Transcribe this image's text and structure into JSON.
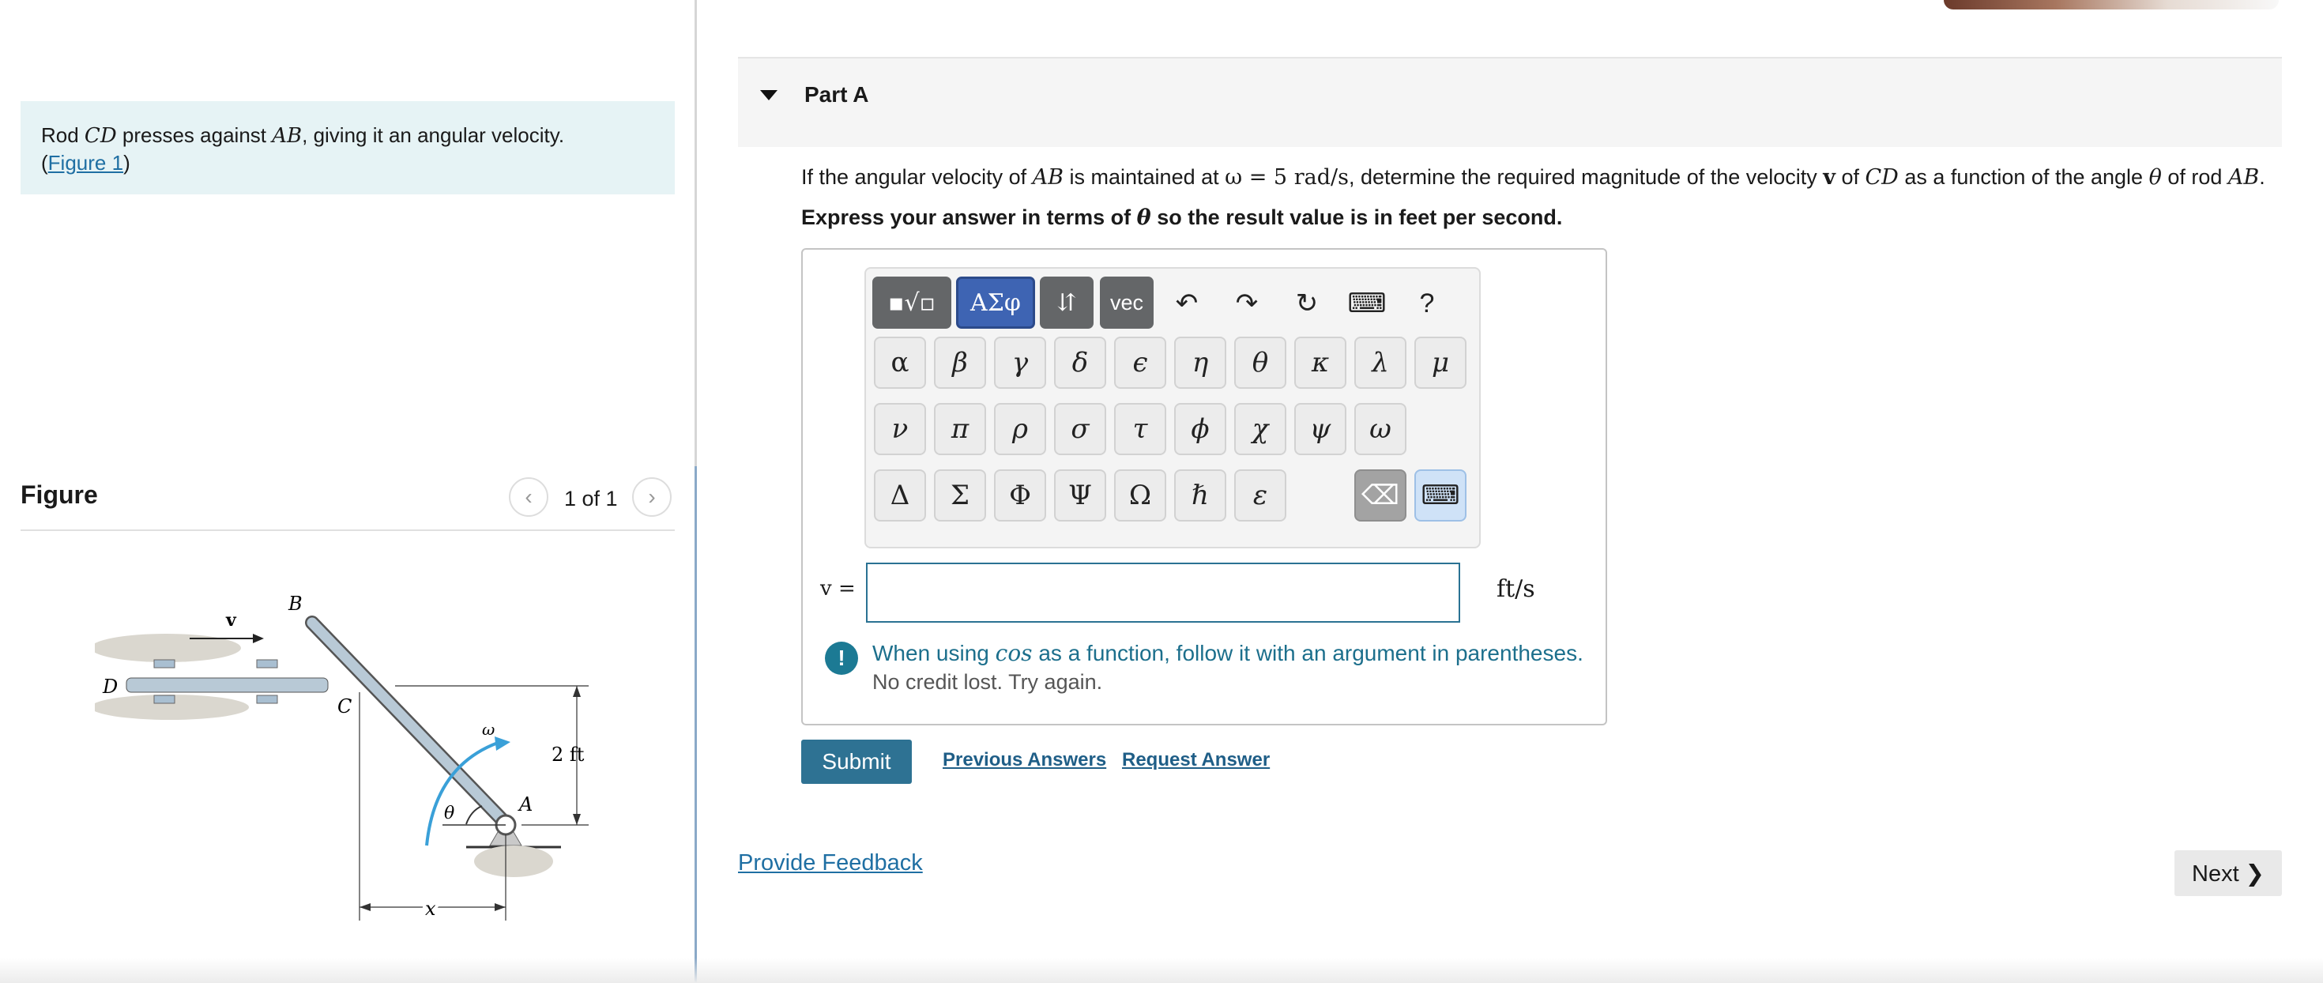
{
  "left": {
    "prompt_text_a": "Rod ",
    "prompt_math_a": "CD",
    "prompt_text_b": " presses against ",
    "prompt_math_b": "AB",
    "prompt_text_c": ", giving it an angular velocity.",
    "prompt_paren_open": "(",
    "figure_link": "Figure 1",
    "prompt_paren_close": ")",
    "figure_title": "Figure",
    "figure_count": "1 of 1",
    "prev_icon": "chevron-left-icon",
    "next_icon": "chevron-right-icon",
    "figure_labels": {
      "B": "B",
      "D": "D",
      "C": "C",
      "A": "A",
      "v": "v",
      "omega": "ω",
      "theta": "θ",
      "dim": "2 ft",
      "x": "x"
    },
    "figure_colors": {
      "ground": "#d9d6cf",
      "rod": "#b8c9d6",
      "arrow": "#3aa0d8",
      "stone": "#9c9790"
    }
  },
  "part": {
    "title": "Part A",
    "q_1": "If the angular velocity of ",
    "q_ab": "AB",
    "q_2": " is maintained at ",
    "q_omega": "ω = 5 rad/s",
    "q_3": ", determine the required magnitude of the velocity ",
    "q_v": "v",
    "q_4": " of ",
    "q_cd": "CD",
    "q_5": " as a function of the angle ",
    "q_theta": "θ",
    "q_6": " of rod ",
    "q_ab2": "AB",
    "q_7": ".",
    "instr_1": "Express your answer in terms of ",
    "instr_theta": "θ",
    "instr_2": " so the result value is in feet per second."
  },
  "toolbar": {
    "templates_label": "▪√▫",
    "greek_label": "ΑΣφ",
    "arrows_label": "⇵",
    "vec_label": "vec",
    "undo_icon": "↶",
    "redo_icon": "↷",
    "reset_icon": "↻",
    "keyboard_icon": "⌨",
    "help_label": "?",
    "row1": [
      "α",
      "β",
      "γ",
      "δ",
      "ϵ",
      "η",
      "θ",
      "κ",
      "λ",
      "μ"
    ],
    "row2": [
      "ν",
      "π",
      "ρ",
      "σ",
      "τ",
      "ϕ",
      "χ",
      "ψ",
      "ω"
    ],
    "row3": [
      "Δ",
      "Σ",
      "Φ",
      "Ψ",
      "Ω",
      "ℏ",
      "ε"
    ],
    "backspace_icon": "⌫",
    "keyboard_toggle_icon": "⌨"
  },
  "answer": {
    "var_label": "v =",
    "value": "",
    "units": "ft/s",
    "warning_icon": "!",
    "warning_1": "When using ",
    "warning_fn": "cos",
    "warning_2": " as a function, follow it with an argument in parentheses.",
    "warning_sub": "No credit lost. Try again."
  },
  "actions": {
    "submit": "Submit",
    "previous_answers": "Previous Answers",
    "request_answer": "Request Answer",
    "feedback": "Provide Feedback",
    "next": "Next ❯"
  }
}
